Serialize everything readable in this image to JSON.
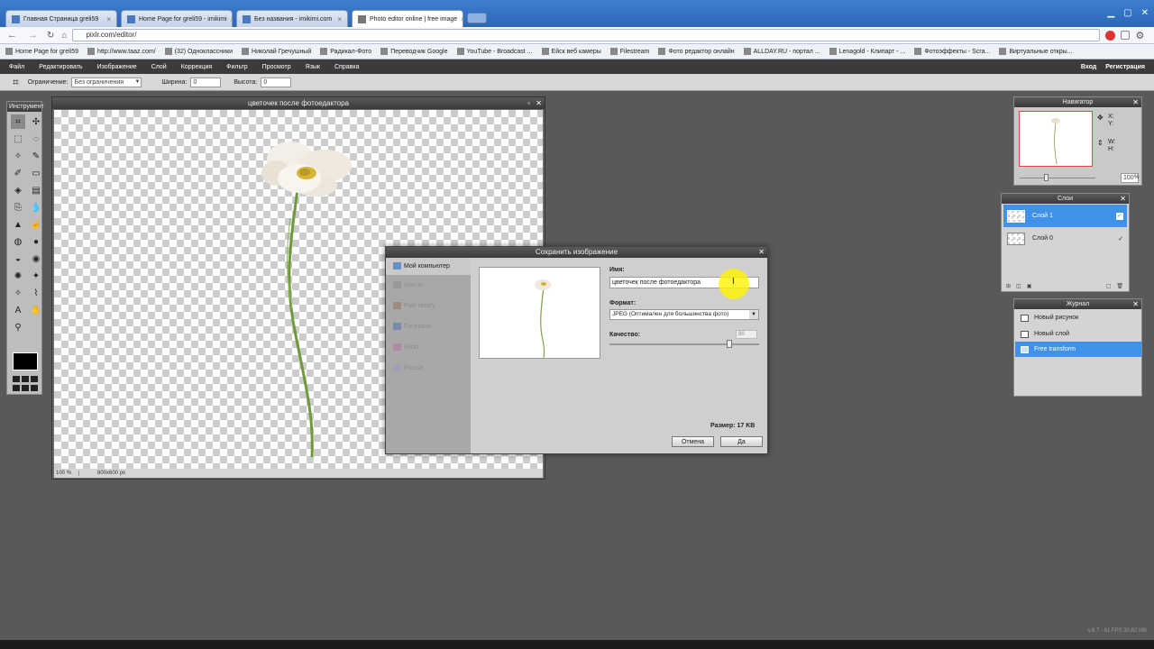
{
  "browser": {
    "tabs": [
      {
        "label": "Главная Страница greli59"
      },
      {
        "label": "Home Page for greli59 - imikimi"
      },
      {
        "label": "Без названия - imikimi.com"
      },
      {
        "label": "Photo editor online | free image"
      }
    ],
    "tab_close": "×",
    "url": "pixlr.com/editor/",
    "bookmarks": [
      "Home Page for greli59",
      "http://www.taaz.com/",
      "(32) Одноклассники",
      "Николай Гречушный",
      "Радикал-Фото",
      "Переводчик Google",
      "YouTube - Broadcast ...",
      "Ейск веб камеры",
      "Filestream",
      "Фото редактор онлайн",
      "ALLDAY.RU - портал ...",
      "Lenagold - Клипарт - ...",
      "Фотоэффекты - Scra...",
      "Виртуальные откры..."
    ]
  },
  "menu": {
    "items": [
      "Файл",
      "Редактировать",
      "Изображение",
      "Слой",
      "Коррекция",
      "Фильтр",
      "Просмотр",
      "Язык",
      "Справка"
    ],
    "login": "Вход",
    "register": "Регистрация"
  },
  "options": {
    "limit_label": "Ограничение:",
    "limit_value": "Без ограничения",
    "width_label": "Ширина:",
    "width_value": "0",
    "height_label": "Высота:",
    "height_value": "0"
  },
  "toolbox": {
    "title": "Инструмент"
  },
  "document": {
    "title": "цветочек после фотоедактора",
    "zoom": "100",
    "zoom_unit": "%",
    "size": "800x600 px"
  },
  "dialog": {
    "title": "Сохранить изображение",
    "sources": [
      "Мой компьютер",
      "Imm.io",
      "Pixlr library",
      "Facebook",
      "Flickr",
      "Picasa"
    ],
    "name_label": "Имя:",
    "name_value": "цветочек после фотоедактора",
    "format_label": "Формат:",
    "format_value": "JPEG (Оптимален для большинства фото)",
    "quality_label": "Качество:",
    "quality_value": "80",
    "quality": 0.8,
    "size_text": "Размер: 17 KB",
    "cancel": "Отмена",
    "ok": "Да"
  },
  "navigator": {
    "title": "Навигатор",
    "x_label": "X:",
    "y_label": "Y:",
    "w_label": "W:",
    "h_label": "H:",
    "zoom": "100",
    "zoom_unit": "%"
  },
  "layers": {
    "title": "Слои",
    "items": [
      {
        "label": "Слой 1"
      },
      {
        "label": "Слой 0"
      }
    ]
  },
  "history": {
    "title": "Журнал",
    "items": [
      {
        "label": "Новый рисунок"
      },
      {
        "label": "Новый слой"
      },
      {
        "label": "Free transform"
      }
    ]
  },
  "status": {
    "fps": "v.6.7 - 61 FPS 30.82 MB"
  },
  "colors": {
    "accent": "#3f91ea",
    "highlight": "#fff200",
    "bg": "#595959"
  }
}
